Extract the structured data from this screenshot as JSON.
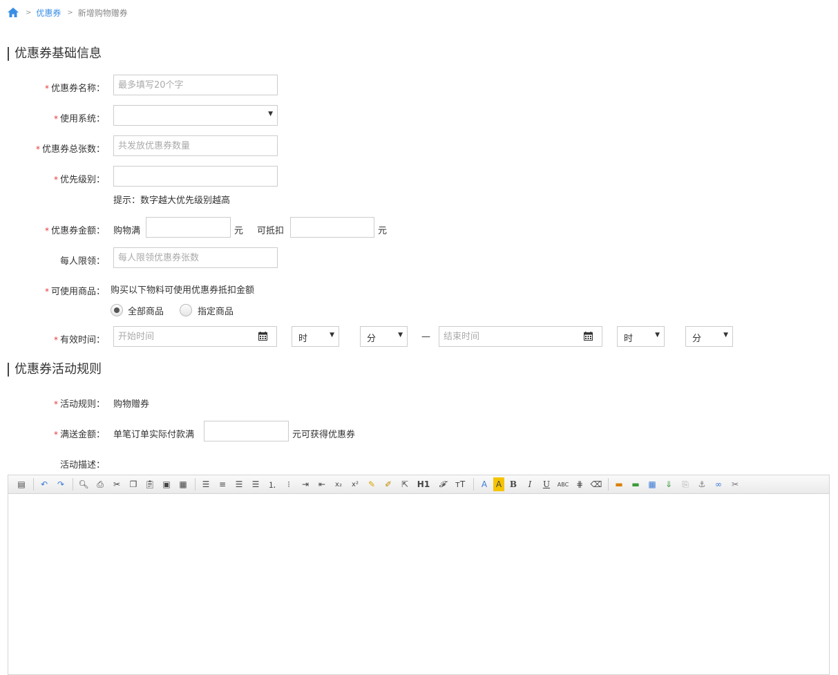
{
  "breadcrumb": {
    "sep": ">",
    "level1": "优惠券",
    "level2": "新增购物赠券"
  },
  "section1": {
    "title": "优惠券基础信息"
  },
  "fields": {
    "required_mark": "*",
    "name": {
      "label": "优惠券名称：",
      "placeholder": "最多填写20个字"
    },
    "system": {
      "label": "使用系统：",
      "value": ""
    },
    "total": {
      "label": "优惠券总张数：",
      "placeholder": "共发放优惠券数量"
    },
    "priority": {
      "label": "优先级别：",
      "hint": "提示：数字越大优先级别越高"
    },
    "amount": {
      "label": "优惠券金额：",
      "prefix1": "购物满",
      "unit1": "元",
      "prefix2": "可抵扣",
      "unit2": "元"
    },
    "limit": {
      "label": "每人限领：",
      "placeholder": "每人限领优惠券张数"
    },
    "goods": {
      "label": "可使用商品：",
      "desc": "购买以下物料可使用优惠券抵扣金额",
      "opt_all": "全部商品",
      "opt_specified": "指定商品",
      "selected": "全部商品"
    },
    "time": {
      "label": "有效时间：",
      "start_placeholder": "开始时间",
      "end_placeholder": "结束时间",
      "hour": "时",
      "minute": "分",
      "dash": "—"
    }
  },
  "section2": {
    "title": "优惠券活动规则"
  },
  "rules": {
    "rule": {
      "label": "活动规则：",
      "value": "购物赠券"
    },
    "threshold": {
      "label": "满送金额：",
      "prefix": "单笔订单实际付款满",
      "suffix": "元可获得优惠券"
    },
    "desc": {
      "label": "活动描述："
    }
  },
  "editor": {
    "toolbar": [
      "H1",
      "ABC"
    ]
  }
}
